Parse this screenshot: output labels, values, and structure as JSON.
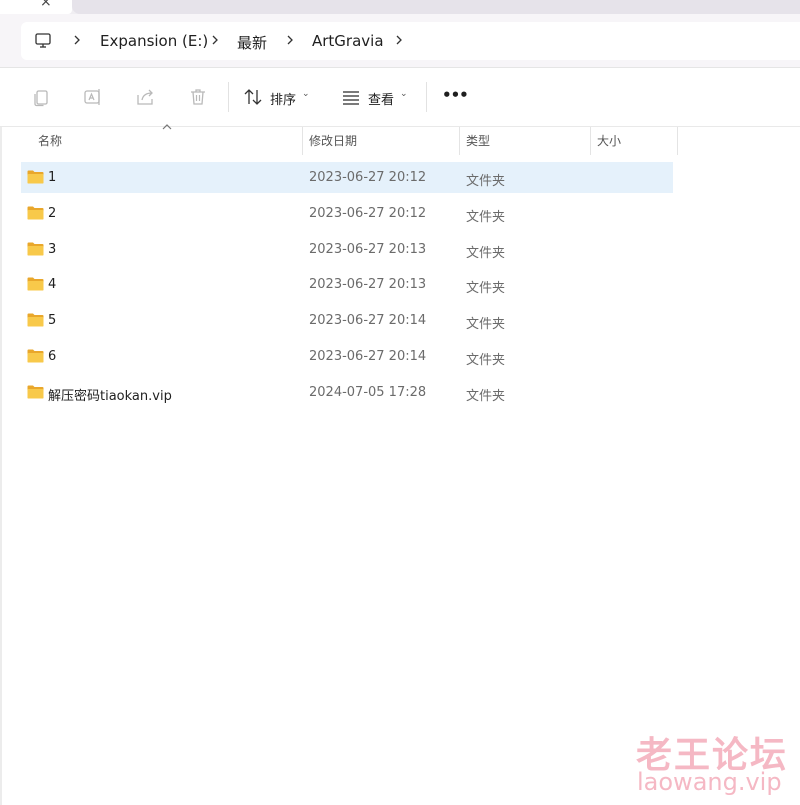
{
  "breadcrumb": {
    "items": [
      "Expansion (E:)",
      "最新",
      "ArtGravia"
    ]
  },
  "toolbar": {
    "sort_label": "排序",
    "view_label": "查看",
    "more_label": "•••"
  },
  "columns": {
    "name": "名称",
    "date": "修改日期",
    "type": "类型",
    "size": "大小"
  },
  "rows": [
    {
      "name": "1",
      "date": "2023-06-27 20:12",
      "type": "文件夹",
      "selected": true
    },
    {
      "name": "2",
      "date": "2023-06-27 20:12",
      "type": "文件夹"
    },
    {
      "name": "3",
      "date": "2023-06-27 20:13",
      "type": "文件夹"
    },
    {
      "name": "4",
      "date": "2023-06-27 20:13",
      "type": "文件夹"
    },
    {
      "name": "5",
      "date": "2023-06-27 20:14",
      "type": "文件夹"
    },
    {
      "name": "6",
      "date": "2023-06-27 20:14",
      "type": "文件夹"
    },
    {
      "name": "解压密码tiaokan.vip",
      "date": "2024-07-05 17:28",
      "type": "文件夹"
    }
  ],
  "watermark": {
    "title": "老王论坛",
    "url": "laowang.vip"
  },
  "colors": {
    "selection": "#e5f1fb",
    "folder": "#f8c94a",
    "watermark": "#f5b8c4"
  },
  "icons": [
    "this-pc-icon",
    "chevron-right-icon",
    "copy-icon",
    "rename-icon",
    "share-icon",
    "delete-icon",
    "sort-icon",
    "view-icon",
    "chevron-down-icon",
    "folder-icon"
  ]
}
